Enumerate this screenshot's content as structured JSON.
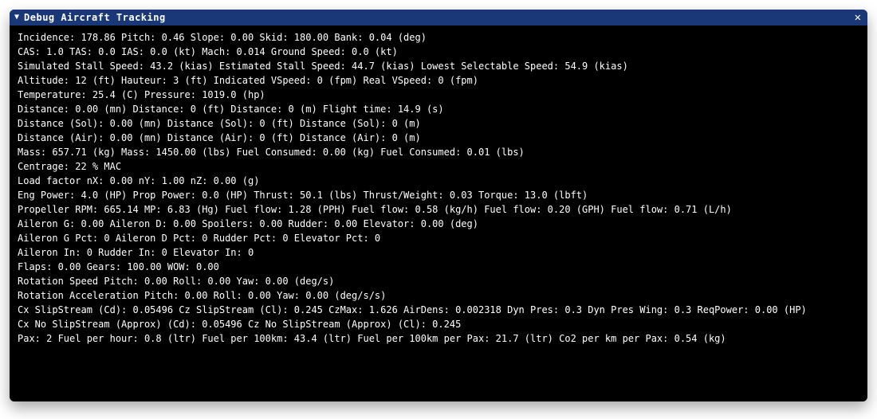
{
  "window": {
    "title": "Debug Aircraft Tracking",
    "collapse_icon": "▼",
    "close_icon": "✕"
  },
  "chart_data": {
    "type": "table",
    "title": "Debug Aircraft Tracking",
    "rows": [
      {
        "Incidence": 178.86,
        "Pitch": 0.46,
        "Slope": 0.0,
        "Skid": 180.0,
        "Bank": 0.04,
        "unit": "deg"
      },
      {
        "CAS": 1.0,
        "TAS": 0.0,
        "IAS": 0.0,
        "unit_speed": "kt",
        "Mach": 0.014,
        "Ground Speed": 0.0,
        "unit_gs": "kt"
      },
      {
        "Simulated Stall Speed": 43.2,
        "Estimated Stall Speed": 44.7,
        "Lowest Selectable Speed": 54.9,
        "unit": "kias"
      },
      {
        "Altitude": 12,
        "Altitude_unit": "ft",
        "Hauteur": 3,
        "Hauteur_unit": "ft",
        "Indicated VSpeed": 0,
        "Real VSpeed": 0,
        "vs_unit": "fpm"
      },
      {
        "Temperature": 25.4,
        "Temperature_unit": "C",
        "Pressure": 1019.0,
        "Pressure_unit": "hp"
      },
      {
        "Distance_mn": 0.0,
        "Distance_ft": 0,
        "Distance_m": 0,
        "Flight time": 14.9,
        "ft_unit": "s"
      },
      {
        "Distance (Sol)_mn": 0.0,
        "Distance (Sol)_ft": 0,
        "Distance (Sol)_m": 0
      },
      {
        "Distance (Air)_mn": 0.0,
        "Distance (Air)_ft": 0,
        "Distance (Air)_m": 0
      },
      {
        "Mass_kg": 657.71,
        "Mass_lbs": 1450.0,
        "Fuel Consumed_kg": 0.0,
        "Fuel Consumed_lbs": 0.01
      },
      {
        "Centrage": 22,
        "Centrage_unit": "% MAC"
      },
      {
        "Load factor nX": 0.0,
        "nY": 1.0,
        "nZ": 0.0,
        "unit": "g"
      },
      {
        "Eng Power": 4.0,
        "Prop Power": 0.0,
        "power_unit": "HP",
        "Thrust": 50.1,
        "thrust_unit": "lbs",
        "Thrust/Weight": 0.03,
        "Torque": 13.0,
        "torque_unit": "lbft"
      },
      {
        "Propeller RPM": 665.14,
        "MP": 6.83,
        "MP_unit": "Hg",
        "Fuel flow_PPH": 1.28,
        "Fuel flow_kgh": 0.58,
        "Fuel flow_GPH": 0.2,
        "Fuel flow_Lh": 0.71
      },
      {
        "Aileron G": 0.0,
        "Aileron D": 0.0,
        "Spoilers": 0.0,
        "Rudder": 0.0,
        "Elevator": 0.0,
        "unit": "deg"
      },
      {
        "Aileron G Pct": 0,
        "Aileron D Pct": 0,
        "Rudder Pct": 0,
        "Elevator Pct": 0
      },
      {
        "Aileron In": 0,
        "Rudder In": 0,
        "Elevator In": 0
      },
      {
        "Flaps": 0.0,
        "Gears": 100.0,
        "WOW": 0.0
      },
      {
        "Rotation Speed Pitch": 0.0,
        "Roll": 0.0,
        "Yaw": 0.0,
        "unit": "deg/s"
      },
      {
        "Rotation Acceleration Pitch": 0.0,
        "Roll": 0.0,
        "Yaw": 0.0,
        "unit": "deg/s/s"
      },
      {
        "Cx SlipStream (Cd)": 0.05496,
        "Cz SlipStream (Cl)": 0.245,
        "CzMax": 1.626,
        "AirDens": 0.002318,
        "Dyn Pres": 0.3,
        "Dyn Pres Wing": 0.3,
        "ReqPower": 0.0,
        "ReqPower_unit": "HP"
      },
      {
        "Cx No SlipStream (Approx) (Cd)": 0.05496,
        "Cz No SlipStream (Approx) (Cl)": 0.245
      },
      {
        "Pax": 2,
        "Fuel per hour": 0.8,
        "fph_unit": "ltr",
        "Fuel per 100km": 43.4,
        "Fuel per 100km per Pax": 21.7,
        "Co2 per km per Pax": 0.54,
        "co2_unit": "kg"
      }
    ]
  },
  "lines": [
    "Incidence: 178.86  Pitch: 0.46  Slope: 0.00  Skid: 180.00  Bank: 0.04 (deg)",
    "CAS: 1.0  TAS: 0.0  IAS: 0.0 (kt)  Mach: 0.014  Ground Speed: 0.0 (kt)",
    "Simulated Stall Speed: 43.2 (kias)  Estimated Stall Speed: 44.7 (kias)  Lowest Selectable Speed: 54.9 (kias)",
    "Altitude: 12 (ft)  Hauteur: 3 (ft)  Indicated VSpeed: 0 (fpm)  Real VSpeed: 0 (fpm)",
    "Temperature: 25.4 (C)  Pressure: 1019.0 (hp)",
    "Distance: 0.00 (mn)  Distance: 0 (ft)  Distance: 0 (m)  Flight time: 14.9 (s)",
    "Distance (Sol): 0.00 (mn)  Distance (Sol): 0 (ft)  Distance (Sol): 0 (m)",
    "Distance (Air): 0.00 (mn)  Distance (Air): 0 (ft)  Distance (Air): 0 (m)",
    "Mass: 657.71 (kg)  Mass: 1450.00 (lbs)  Fuel Consumed: 0.00 (kg)  Fuel Consumed: 0.01 (lbs)",
    "Centrage: 22 % MAC",
    "Load factor nX: 0.00  nY: 1.00  nZ: 0.00 (g)",
    "Eng Power: 4.0 (HP)  Prop Power: 0.0 (HP)  Thrust: 50.1 (lbs)  Thrust/Weight: 0.03  Torque: 13.0 (lbft)",
    "Propeller RPM: 665.14  MP: 6.83 (Hg)  Fuel flow: 1.28 (PPH)  Fuel flow: 0.58 (kg/h)  Fuel flow: 0.20 (GPH)  Fuel flow: 0.71 (L/h)",
    "Aileron G: 0.00  Aileron D: 0.00  Spoilers: 0.00  Rudder: 0.00  Elevator: 0.00 (deg)",
    "Aileron G Pct: 0  Aileron D Pct: 0  Rudder Pct: 0  Elevator Pct: 0",
    "Aileron In: 0  Rudder In: 0  Elevator In: 0",
    "Flaps: 0.00  Gears: 100.00  WOW: 0.00",
    "Rotation Speed Pitch: 0.00  Roll: 0.00  Yaw: 0.00 (deg/s)",
    "Rotation Acceleration Pitch: 0.00  Roll: 0.00  Yaw: 0.00 (deg/s/s)",
    "Cx SlipStream (Cd): 0.05496  Cz SlipStream (Cl): 0.245  CzMax: 1.626  AirDens: 0.002318  Dyn Pres: 0.3  Dyn Pres Wing: 0.3  ReqPower: 0.00 (HP)",
    "Cx No SlipStream (Approx) (Cd): 0.05496  Cz No SlipStream (Approx) (Cl): 0.245",
    "Pax: 2  Fuel per hour: 0.8 (ltr)  Fuel per 100km: 43.4 (ltr)  Fuel per 100km per Pax: 21.7 (ltr)  Co2 per km per Pax: 0.54 (kg)"
  ]
}
